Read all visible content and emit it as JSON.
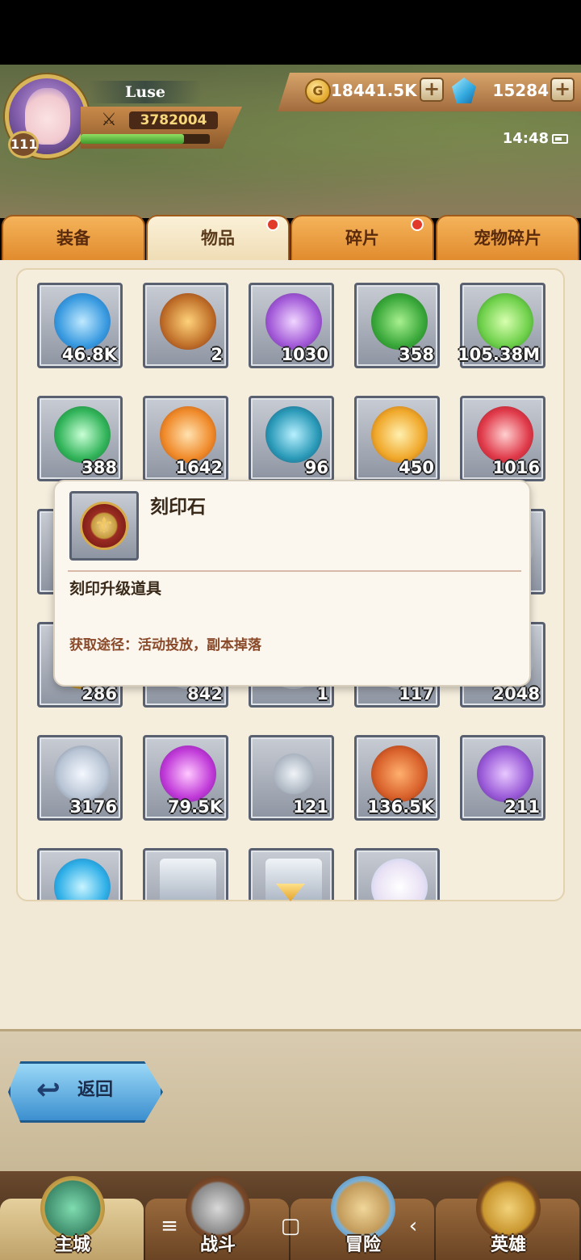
{
  "player": {
    "name": "Luse",
    "level": "111",
    "power": "3782004",
    "exp_fraction": 0.8
  },
  "currency": {
    "gold": "18441.5K",
    "gems": "15284"
  },
  "status_bar": {
    "time": "14:48"
  },
  "tabs": [
    {
      "label": "装备",
      "active": false,
      "dot": false
    },
    {
      "label": "物品",
      "active": true,
      "dot": true
    },
    {
      "label": "碎片",
      "active": false,
      "dot": true
    },
    {
      "label": "宠物碎片",
      "active": false,
      "dot": false
    }
  ],
  "items": [
    {
      "icon": "blue-crystal-icon",
      "count": "46.8K"
    },
    {
      "icon": "rank-emblem-icon",
      "count": "2"
    },
    {
      "icon": "purple-helmet-gem-icon",
      "count": "1030"
    },
    {
      "icon": "four-leaf-clover-icon",
      "count": "358"
    },
    {
      "icon": "green-potion-icon",
      "count": "105.38M"
    },
    {
      "icon": "green-glove-gem-icon",
      "count": "388"
    },
    {
      "icon": "orange-potion-icon",
      "count": "1642"
    },
    {
      "icon": "blue-egg-icon",
      "count": "96"
    },
    {
      "icon": "orange-armor-gem-icon",
      "count": "450"
    },
    {
      "icon": "red-sword-gem-icon",
      "count": "1016"
    },
    {
      "icon": "item-icon",
      "count": ""
    },
    {
      "icon": "item-icon",
      "count": ""
    },
    {
      "icon": "item-icon",
      "count": ""
    },
    {
      "icon": "item-icon",
      "count": ""
    },
    {
      "icon": "item-icon",
      "count": ""
    },
    {
      "icon": "gold-coin-icon",
      "count": "286"
    },
    {
      "icon": "item-icon",
      "count": "842"
    },
    {
      "icon": "item-icon",
      "count": "1"
    },
    {
      "icon": "item-icon",
      "count": "117"
    },
    {
      "icon": "item-icon",
      "count": "2048"
    },
    {
      "icon": "silver-coin-icon",
      "count": "3176"
    },
    {
      "icon": "purple-potion-icon",
      "count": "79.5K"
    },
    {
      "icon": "key-icon",
      "count": "121"
    },
    {
      "icon": "ore-icon",
      "count": "136.5K"
    },
    {
      "icon": "purple-jar-icon",
      "count": "211"
    },
    {
      "icon": "blue-orb-icon",
      "count": ""
    },
    {
      "icon": "silver-chest-icon",
      "count": ""
    },
    {
      "icon": "silver-chest-icon",
      "count": ""
    },
    {
      "icon": "spotted-egg-icon",
      "count": ""
    }
  ],
  "tooltip": {
    "title": "刻印石",
    "description": "刻印升级道具",
    "source": "获取途径：活动投放，副本掉落"
  },
  "back_button": {
    "label": "返回"
  },
  "bottom_nav": [
    {
      "label": "主城",
      "active": true
    },
    {
      "label": "战斗",
      "active": false
    },
    {
      "label": "冒险",
      "active": false
    },
    {
      "label": "英雄",
      "active": false
    }
  ]
}
